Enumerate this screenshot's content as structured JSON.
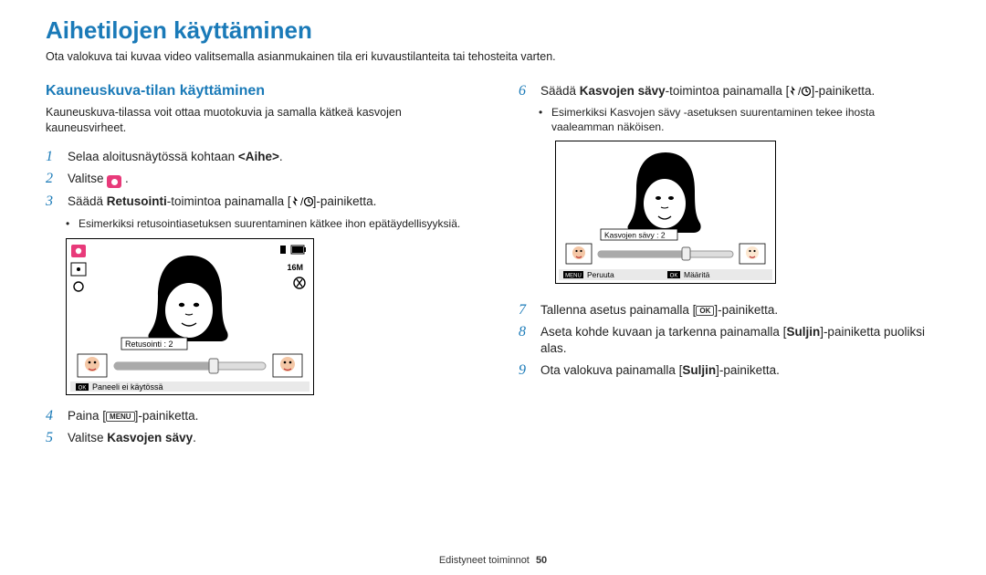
{
  "heading": "Aihetilojen käyttäminen",
  "intro": "Ota valokuva tai kuvaa video valitsemalla asianmukainen tila eri kuvaustilanteita tai tehosteita varten.",
  "left": {
    "subheading": "Kauneuskuva-tilan käyttäminen",
    "sub_p": "Kauneuskuva-tilassa voit ottaa muotokuvia ja samalla kätkeä kasvojen kauneusvirheet.",
    "s1_a": "Selaa aloitusnäytössä kohtaan ",
    "s1_b": "<Aihe>",
    "s1_c": ".",
    "s2_a": "Valitse ",
    "s2_b": ".",
    "s3_a": "Säädä ",
    "s3_b": "Retusointi",
    "s3_c": "-toimintoa painamalla [",
    "s3_d": "]-painiketta.",
    "s3_bullet": "Esimerkiksi retusointiasetuksen suurentaminen kätkee ihon epätäydellisyyksiä.",
    "lcd_retouch_label": "Retusointi : 2",
    "lcd_bottom_label": "Paneeli ei käytössä",
    "s4_a": "Paina [",
    "s4_b": "]-painiketta.",
    "s5_a": "Valitse ",
    "s5_b": "Kasvojen sävy",
    "s5_c": "."
  },
  "right": {
    "s6_a": "Säädä ",
    "s6_b": "Kasvojen sävy",
    "s6_c": "-toimintoa painamalla [",
    "s6_d": "]-painiketta.",
    "s6_bullet": "Esimerkiksi Kasvojen sävy -asetuksen suurentaminen tekee ihosta vaaleamman näköisen.",
    "lcd_tone_label": "Kasvojen sävy : 2",
    "lcd_cancel": "Peruuta",
    "lcd_set": "Määritä",
    "s7_a": "Tallenna asetus painamalla [",
    "s7_b": "]-painiketta.",
    "s8_a": "Aseta kohde kuvaan ja tarkenna painamalla [",
    "s8_b": "Suljin",
    "s8_c": "]-painiketta puoliksi alas.",
    "s9_a": "Ota valokuva painamalla [",
    "s9_b": "Suljin",
    "s9_c": "]-painiketta."
  },
  "keys": {
    "menu": "MENU",
    "ok": "OK"
  },
  "footer": {
    "section": "Edistyneet toiminnot",
    "page": "50"
  }
}
